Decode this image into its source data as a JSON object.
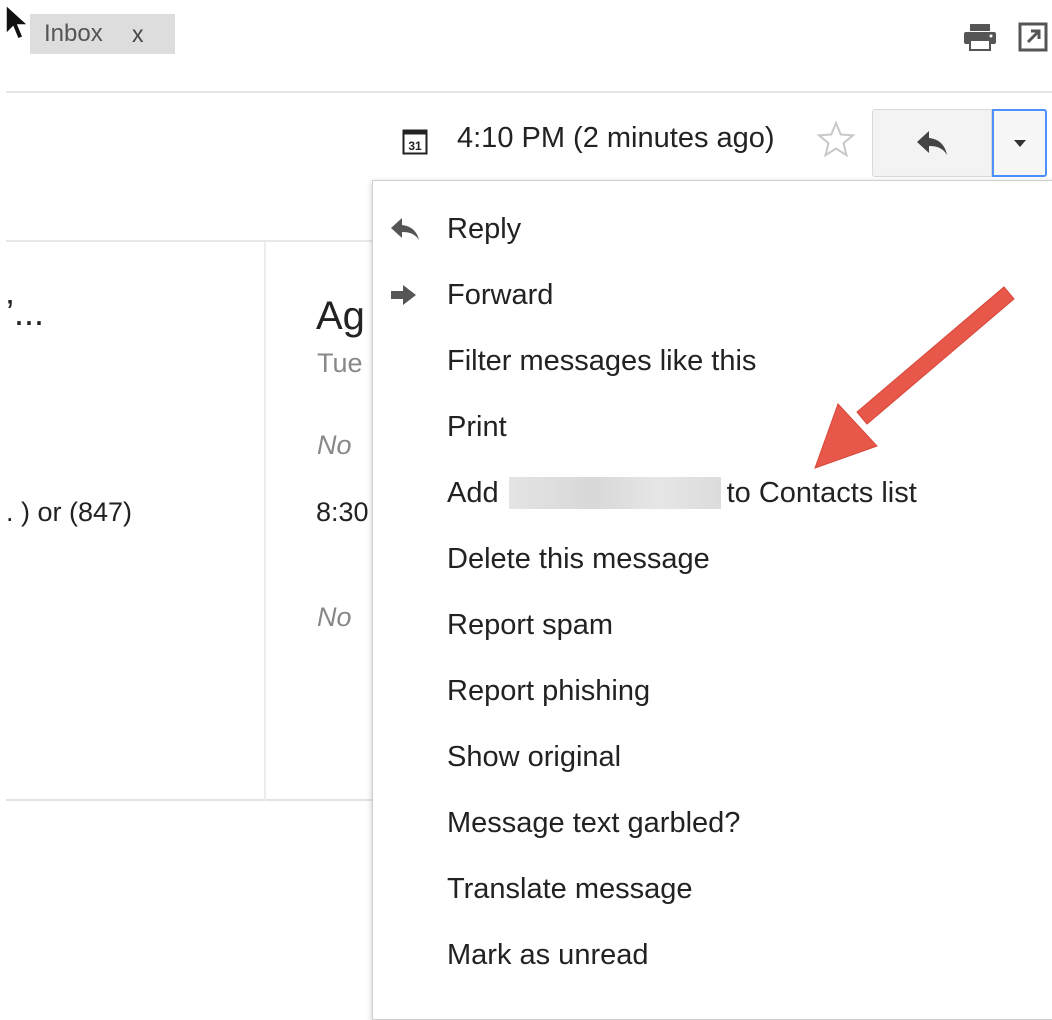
{
  "tab_chip": {
    "label": "Inbox",
    "close": "x"
  },
  "toolbar": {
    "print_icon": "print-icon",
    "new_window_icon": "new-window-icon"
  },
  "message_header": {
    "calendar_icon_text": "31",
    "timestamp": "4:10 PM (2 minutes ago)",
    "star_icon": "star-outline-icon",
    "reply_icon": "reply-arrow-icon",
    "more_icon": "caret-down-icon"
  },
  "background_content": {
    "left_title": "’...",
    "left_phone": ". ) or (847)",
    "right_title": "Ag",
    "right_date": "Tue",
    "right_note_1": "No",
    "right_time": "8:30",
    "right_note_2": "No"
  },
  "menu": {
    "items": [
      {
        "label": "Reply",
        "icon": "reply-icon"
      },
      {
        "label": "Forward",
        "icon": "forward-icon"
      },
      {
        "label": "Filter messages like this"
      },
      {
        "label": "Print"
      },
      {
        "label_prefix": "Add",
        "label_suffix": "to Contacts list"
      },
      {
        "label": "Delete this message"
      },
      {
        "label": "Report spam"
      },
      {
        "label": "Report phishing"
      },
      {
        "label": "Show original"
      },
      {
        "label": "Message text garbled?"
      },
      {
        "label": "Translate message"
      },
      {
        "label": "Mark as unread"
      }
    ]
  },
  "colors": {
    "annotation_arrow": "#e8584a",
    "focus_border": "#4d90fe"
  }
}
